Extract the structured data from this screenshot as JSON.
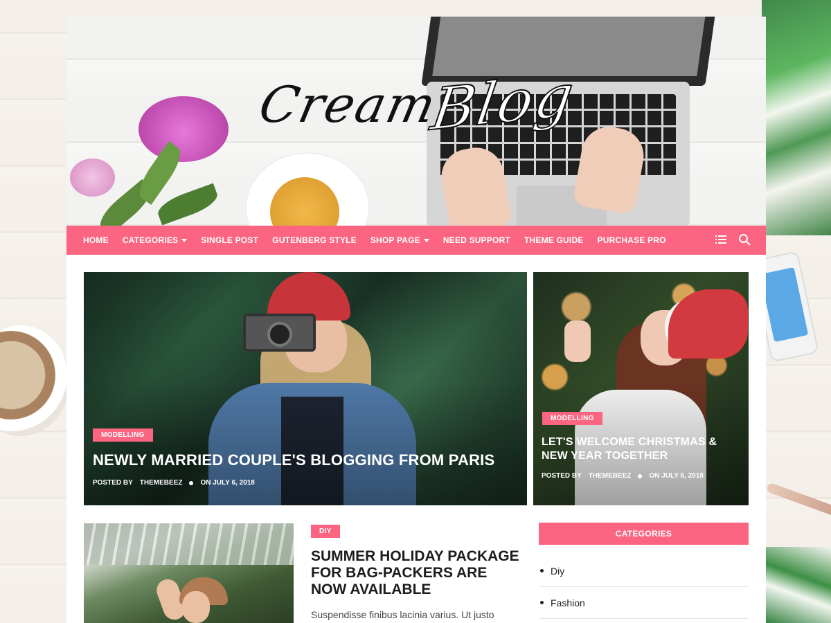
{
  "brand": {
    "logo_word1": "Cream",
    "logo_word2": "Blog",
    "accent_color": "#fc6582"
  },
  "nav": {
    "items": [
      {
        "label": "HOME",
        "dropdown": false
      },
      {
        "label": "CATEGORIES",
        "dropdown": true
      },
      {
        "label": "SINGLE POST",
        "dropdown": false
      },
      {
        "label": "GUTENBERG STYLE",
        "dropdown": false
      },
      {
        "label": "SHOP PAGE",
        "dropdown": true
      },
      {
        "label": "NEED SUPPORT",
        "dropdown": false
      },
      {
        "label": "THEME GUIDE",
        "dropdown": false
      },
      {
        "label": "PURCHASE PRO",
        "dropdown": false
      }
    ],
    "icons": [
      "menu-list-icon",
      "search-icon"
    ]
  },
  "featured": [
    {
      "category": "MODELLING",
      "title": "NEWLY MARRIED COUPLE'S BLOGGING FROM PARIS",
      "posted_by_label": "POSTED BY",
      "author": "THEMEBEEZ",
      "date": "ON JULY 6, 2018"
    },
    {
      "category": "MODELLING",
      "title": "LET'S WELCOME CHRISTMAS & NEW YEAR TOGETHER",
      "posted_by_label": "POSTED BY",
      "author": "THEMEBEEZ",
      "date": "ON JULY 6, 2018"
    }
  ],
  "post": {
    "category": "DIY",
    "title": "SUMMER HOLIDAY PACKAGE FOR BAG-PACKERS ARE NOW AVAILABLE",
    "excerpt": "Suspendisse finibus lacinia varius. Ut justo"
  },
  "sidebar": {
    "widget_title": "CATEGORIES",
    "categories": [
      "Diy",
      "Fashion"
    ]
  }
}
